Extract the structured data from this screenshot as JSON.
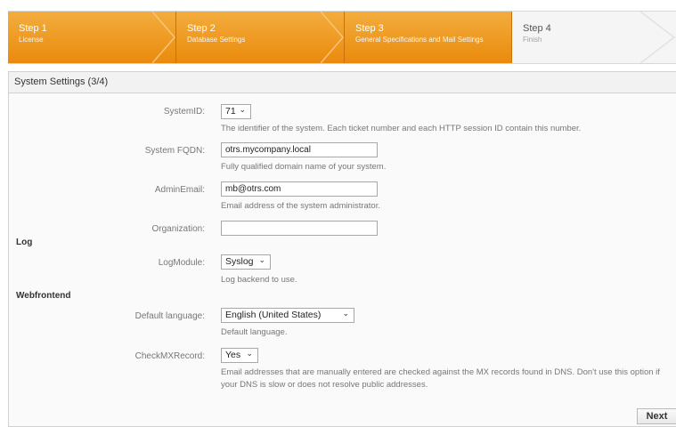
{
  "steps": [
    {
      "title": "Step 1",
      "sub": "License",
      "state": "done"
    },
    {
      "title": "Step 2",
      "sub": "Database Settings",
      "state": "done"
    },
    {
      "title": "Step 3",
      "sub": "General Specifications and Mail Settings",
      "state": "done"
    },
    {
      "title": "Step 4",
      "sub": "Finish",
      "state": "current"
    }
  ],
  "colors": {
    "accent": "#ea8a0c",
    "accent_light": "#f3ad3d"
  },
  "panel": {
    "title": "System Settings (3/4)"
  },
  "form": {
    "system_id": {
      "label": "SystemID:",
      "value": "71",
      "hint": "The identifier of the system. Each ticket number and each HTTP session ID contain this number."
    },
    "fqdn": {
      "label": "System FQDN:",
      "value": "otrs.mycompany.local",
      "hint": "Fully qualified domain name of your system."
    },
    "admin_email": {
      "label": "AdminEmail:",
      "value": "mb@otrs.com",
      "hint": "Email address of the system administrator."
    },
    "organization": {
      "label": "Organization:",
      "value": ""
    },
    "log_section": "Log",
    "log_module": {
      "label": "LogModule:",
      "value": "Syslog",
      "hint": "Log backend to use."
    },
    "web_section": "Webfrontend",
    "default_language": {
      "label": "Default language:",
      "value": "English (United States)",
      "hint": "Default language."
    },
    "check_mx": {
      "label": "CheckMXRecord:",
      "value": "Yes",
      "hint_line1": "Email addresses that are manually entered are checked against the MX records found in DNS. Don't use this option if",
      "hint_line2": "your DNS is slow or does not resolve public addresses."
    }
  },
  "buttons": {
    "next": "Next"
  }
}
